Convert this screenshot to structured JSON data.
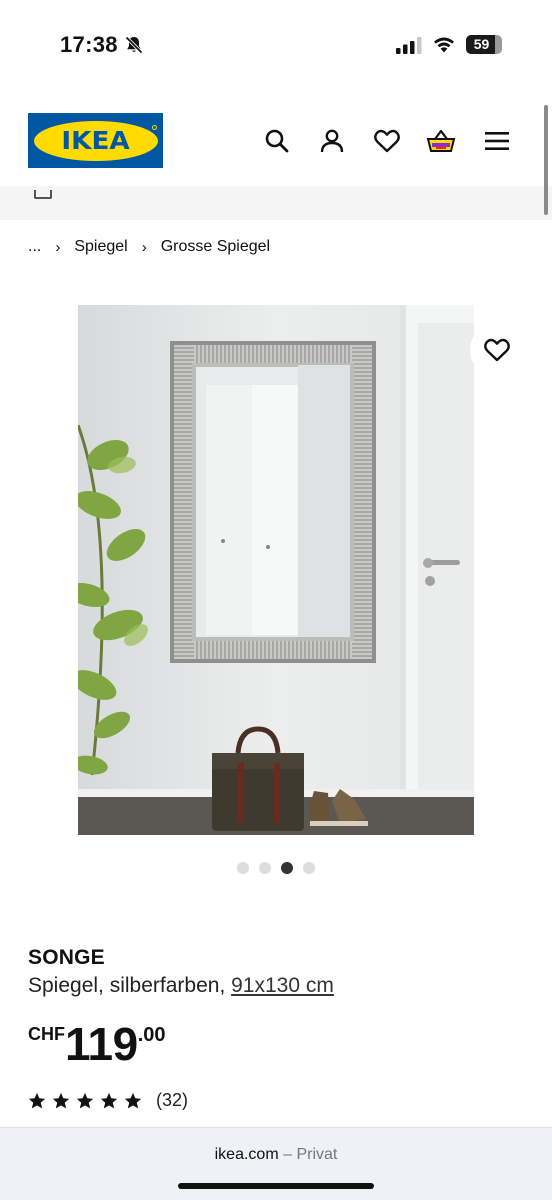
{
  "status_bar": {
    "time": "17:38",
    "battery": "59",
    "icons": [
      "bell-slash-icon",
      "signal-icon",
      "wifi-icon",
      "battery-icon"
    ]
  },
  "header": {
    "logo_text": "IKEA",
    "icons": [
      "search-icon",
      "user-icon",
      "heart-icon",
      "cart-icon",
      "menu-icon"
    ],
    "colors": {
      "brand_blue": "#0058a3",
      "brand_yellow": "#ffdb00"
    }
  },
  "breadcrumb": {
    "items": [
      "...",
      "Spiegel",
      "Grosse Spiegel"
    ]
  },
  "gallery": {
    "image_count": 4,
    "active_index": 2
  },
  "product": {
    "name": "SONGE",
    "description": "Spiegel, silberfarben, ",
    "size": "91x130 cm",
    "price": {
      "currency": "CHF",
      "integer": "119",
      "decimal": ".00"
    },
    "rating": {
      "stars": 5,
      "count": "(32)"
    }
  },
  "browser": {
    "domain": "ikea.com",
    "separator": " – ",
    "mode": "Privat"
  }
}
